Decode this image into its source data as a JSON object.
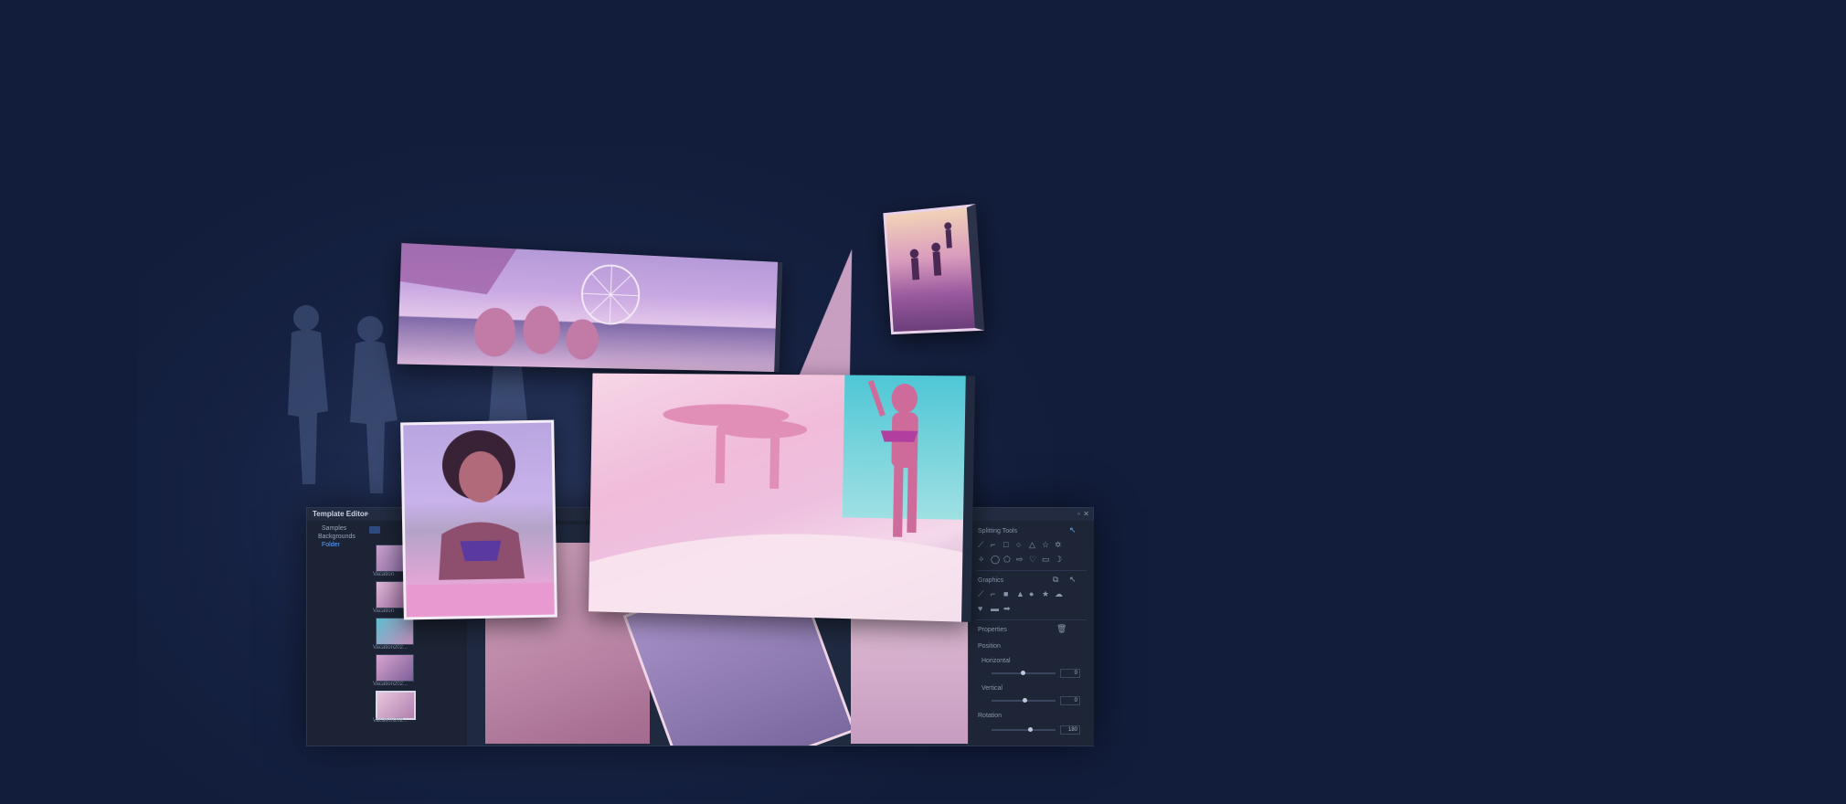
{
  "template_editor": {
    "title": "Template Editor",
    "tree": [
      "Samples",
      "Backgrounds",
      "Folder"
    ],
    "thumbnails": [
      "Vacation",
      "Vacation",
      "Vacation202...",
      "Vacation202...",
      "Vacation202..."
    ]
  },
  "properties_panel": {
    "splitting_tools_label": "Splitting Tools",
    "graphics_label": "Graphics",
    "properties_label": "Properties",
    "position_label": "Position",
    "horizontal_label": "Horizontal",
    "horizontal_value": "0",
    "vertical_label": "Vertical",
    "vertical_value": "0",
    "rotation_label": "Rotation",
    "rotation_value": "180"
  },
  "colors": {
    "background": "#121d3b",
    "accent": "#5ea3ff",
    "photo_tint": "#e7a6d6"
  },
  "icons": [
    "line-icon",
    "rect-icon",
    "ellipse-icon",
    "triangle-icon",
    "star-icon",
    "heart-icon",
    "arrow-icon",
    "trash-icon",
    "close-icon"
  ]
}
